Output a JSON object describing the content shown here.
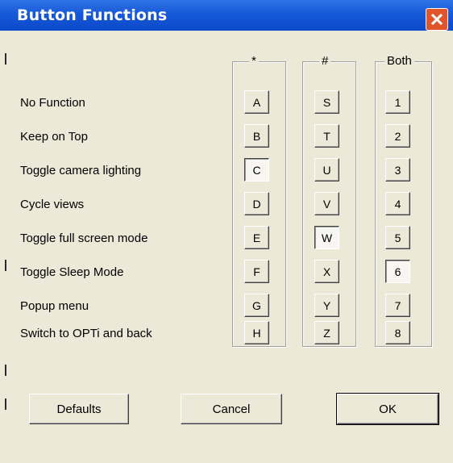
{
  "window": {
    "title": "Button Functions",
    "close_icon": "close-icon",
    "title_color": "#0c49c9",
    "close_color": "#e1552b"
  },
  "functions": [
    "No Function",
    "Keep on Top",
    "Toggle camera lighting",
    "Cycle views",
    "Toggle full screen mode",
    "Toggle Sleep Mode",
    "Popup menu",
    "Switch to OPTi and back"
  ],
  "groups": [
    {
      "title": "*",
      "keys": [
        "A",
        "B",
        "C",
        "D",
        "E",
        "F",
        "G",
        "H"
      ],
      "selected": "C"
    },
    {
      "title": "#",
      "keys": [
        "S",
        "T",
        "U",
        "V",
        "W",
        "X",
        "Y",
        "Z"
      ],
      "selected": "W"
    },
    {
      "title": "Both",
      "keys": [
        "1",
        "2",
        "3",
        "4",
        "5",
        "6",
        "7",
        "8"
      ],
      "selected": "6"
    }
  ],
  "buttons": {
    "defaults": "Defaults",
    "cancel": "Cancel",
    "ok": "OK"
  }
}
